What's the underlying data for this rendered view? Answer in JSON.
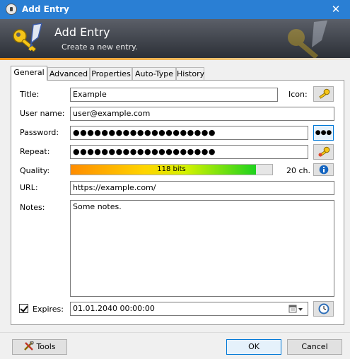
{
  "window": {
    "title": "Add Entry"
  },
  "banner": {
    "title": "Add Entry",
    "subtitle": "Create a new entry."
  },
  "tabs": [
    {
      "label": "General",
      "active": true
    },
    {
      "label": "Advanced",
      "active": false
    },
    {
      "label": "Properties",
      "active": false
    },
    {
      "label": "Auto-Type",
      "active": false
    },
    {
      "label": "History",
      "active": false
    }
  ],
  "form": {
    "title_label": "Title:",
    "title_value": "Example",
    "icon_label": "Icon:",
    "username_label": "User name:",
    "username_value": "user@example.com",
    "password_label": "Password:",
    "password_value": "●●●●●●●●●●●●●●●●●●●●",
    "repeat_label": "Repeat:",
    "repeat_value": "●●●●●●●●●●●●●●●●●●●●",
    "show_password_button": "●●●",
    "quality_label": "Quality:",
    "quality_text": "118 bits",
    "quality_fraction": 0.92,
    "quality_chars": "20 ch.",
    "url_label": "URL:",
    "url_value": "https://example.com/",
    "notes_label": "Notes:",
    "notes_value": "Some notes.",
    "expires_label": "Expires:",
    "expires_checked": true,
    "expires_value": "01.01.2040 00:00:00"
  },
  "footer": {
    "tools_label": "Tools",
    "ok_label": "OK",
    "cancel_label": "Cancel"
  },
  "colors": {
    "titlebar": "#2a7fd4",
    "accent": "#0078d7",
    "info": "#1565c0"
  },
  "icons": {
    "app": "lock-icon",
    "banner": "key-pen-icon",
    "entry_icon": "key-icon",
    "generate": "key-gear-icon",
    "info": "info-icon",
    "expiry_presets": "clock-icon",
    "tools": "tools-icon"
  }
}
